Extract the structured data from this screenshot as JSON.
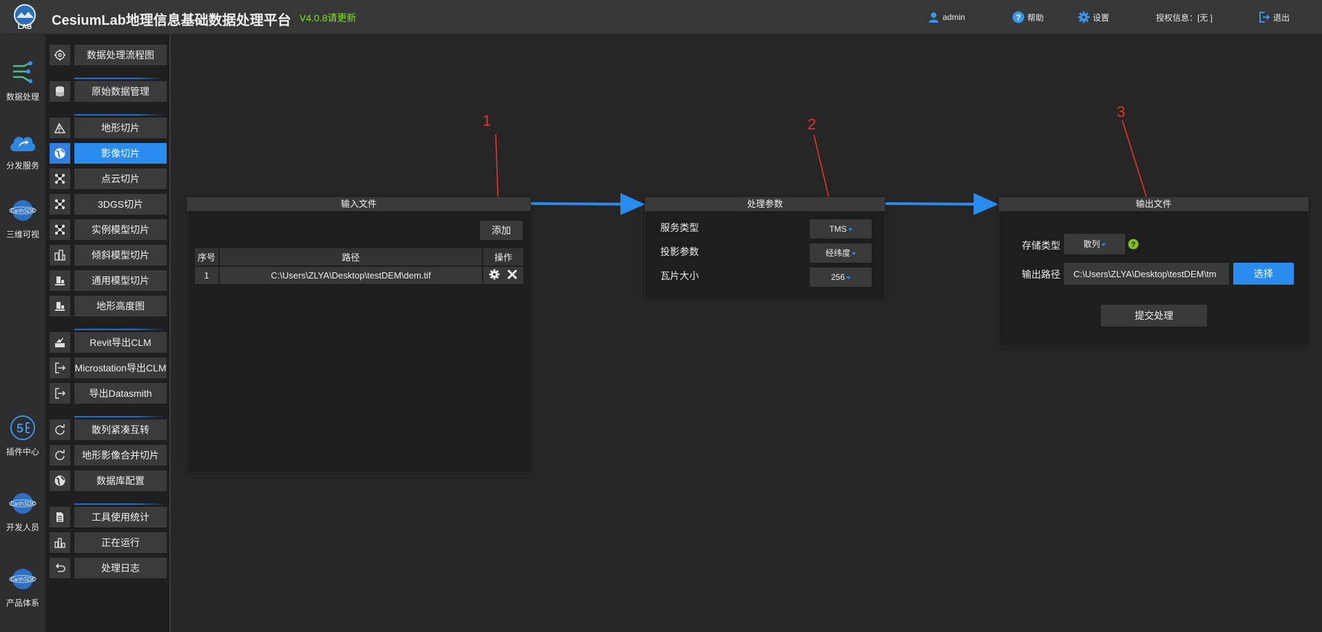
{
  "header": {
    "title": "CesiumLab地理信息基础数据处理平台",
    "version": "V4.0.8请更新",
    "logo_text": "LAB",
    "user": "admin",
    "help": "帮助",
    "settings": "设置",
    "license": "授权信息：[无 ]",
    "logout": "退出"
  },
  "leftbar": {
    "items": [
      {
        "label": "数据处理",
        "icon": "data-process-icon"
      },
      {
        "label": "分发服务",
        "icon": "cloud-share-icon"
      },
      {
        "label": "三维可视",
        "icon": "earth-sdk-icon"
      },
      {
        "label": "插件中心",
        "icon": "plugin-icon"
      },
      {
        "label": "开发人员",
        "icon": "earth-sdk-icon"
      },
      {
        "label": "产品体系",
        "icon": "earth-sdk-icon"
      }
    ]
  },
  "menu": {
    "items": [
      {
        "label": "数据处理流程图",
        "icon": "gear-icon"
      },
      {
        "label": "原始数据管理",
        "icon": "database-icon"
      },
      {
        "label": "地形切片",
        "icon": "terrain-icon"
      },
      {
        "label": "影像切片",
        "icon": "globe-icon",
        "active": true
      },
      {
        "label": "点云切片",
        "icon": "point-cloud-icon"
      },
      {
        "label": "3DGS切片",
        "icon": "point-cloud-icon"
      },
      {
        "label": "实例模型切片",
        "icon": "point-cloud-icon"
      },
      {
        "label": "倾斜模型切片",
        "icon": "building-icon"
      },
      {
        "label": "通用模型切片",
        "icon": "model-icon"
      },
      {
        "label": "地形高度图",
        "icon": "model-icon"
      },
      {
        "label": "Revit导出CLM",
        "icon": "revit-icon"
      },
      {
        "label": "Microstation导出CLM",
        "icon": "export-icon"
      },
      {
        "label": "导出Datasmith",
        "icon": "export-icon"
      },
      {
        "label": "散列紧凑互转",
        "icon": "refresh-icon"
      },
      {
        "label": "地形影像合并切片",
        "icon": "refresh-icon"
      },
      {
        "label": "数据库配置",
        "icon": "globe-icon"
      },
      {
        "label": "工具使用统计",
        "icon": "document-icon"
      },
      {
        "label": "正在运行",
        "icon": "chart-icon"
      },
      {
        "label": "处理日志",
        "icon": "undo-icon"
      }
    ]
  },
  "input_panel": {
    "title": "输入文件",
    "add_label": "添加",
    "columns": [
      "序号",
      "路径",
      "操作"
    ],
    "rows": [
      {
        "index": "1",
        "path": "C:\\Users\\ZLYA\\Desktop\\testDEM\\dem.tif"
      }
    ]
  },
  "params_panel": {
    "title": "处理参数",
    "service_type_label": "服务类型",
    "service_type_value": "TMS",
    "projection_label": "投影参数",
    "projection_value": "经纬度",
    "tile_size_label": "瓦片大小",
    "tile_size_value": "256"
  },
  "output_panel": {
    "title": "输出文件",
    "storage_type_label": "存储类型",
    "storage_type_value": "散列",
    "output_path_label": "输出路径",
    "output_path_value": "C:\\Users\\ZLYA\\Desktop\\testDEM\\tm",
    "choose_label": "选择",
    "submit_label": "提交处理"
  },
  "annotations": [
    "1",
    "2",
    "3"
  ],
  "colors": {
    "accent": "#2b8cf0",
    "version": "#7fe31c",
    "annotation": "#e8332a",
    "help_badge": "#7fc31c"
  }
}
